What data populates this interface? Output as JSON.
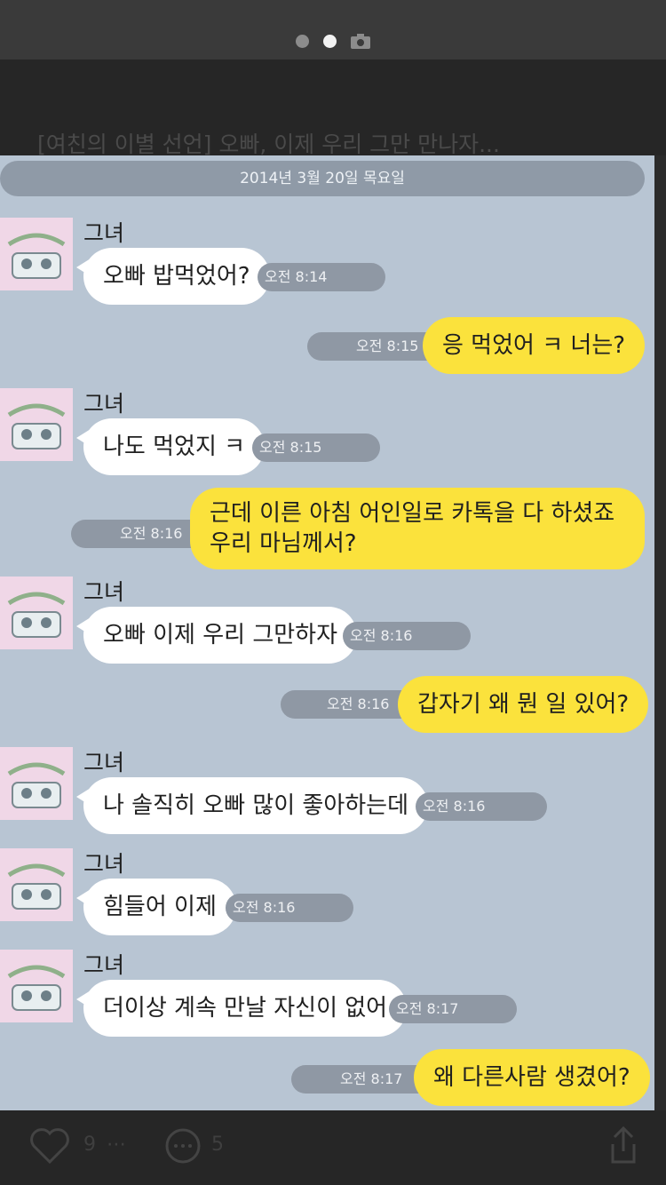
{
  "caption": "[여친의 이별 선언] 오빠, 이제 우리 그만 만나자...",
  "date": "2014년 3월 20일 목요일",
  "sender_name": "그녀",
  "messages": [
    {
      "side": "recv",
      "text": "오빠 밥먹었어?",
      "time": "오전 8:14"
    },
    {
      "side": "sent",
      "text": "응 먹었어 ㅋ 너는?",
      "time": "오전 8:15"
    },
    {
      "side": "recv",
      "text": "나도 먹었지 ㅋ",
      "time": "오전 8:15"
    },
    {
      "side": "sent",
      "line1": "근데 이른 아침 어인일로 카톡을 다 하셨죠",
      "line2": "우리 마님께서?",
      "time": "오전 8:16"
    },
    {
      "side": "recv",
      "text": "오빠 이제 우리 그만하자",
      "time": "오전 8:16"
    },
    {
      "side": "sent",
      "text": "갑자기 왜 뭔 일 있어?",
      "time": "오전 8:16"
    },
    {
      "side": "recv",
      "text": "나 솔직히 오빠 많이 좋아하는데",
      "time": "오전 8:16"
    },
    {
      "side": "recv",
      "text": "힘들어 이제",
      "time": "오전 8:16"
    },
    {
      "side": "recv",
      "text": "더이상 계속 만날 자신이 없어",
      "time": "오전 8:17"
    },
    {
      "side": "sent",
      "text": "왜 다른사람 생겼어?",
      "time": "오전 8:17"
    }
  ],
  "footer": {
    "likes": "9",
    "more": "⋯",
    "comments": "5"
  },
  "icons": {
    "camera": "camera-icon",
    "like": "heart-icon",
    "comment": "comment-icon",
    "share": "share-icon"
  }
}
